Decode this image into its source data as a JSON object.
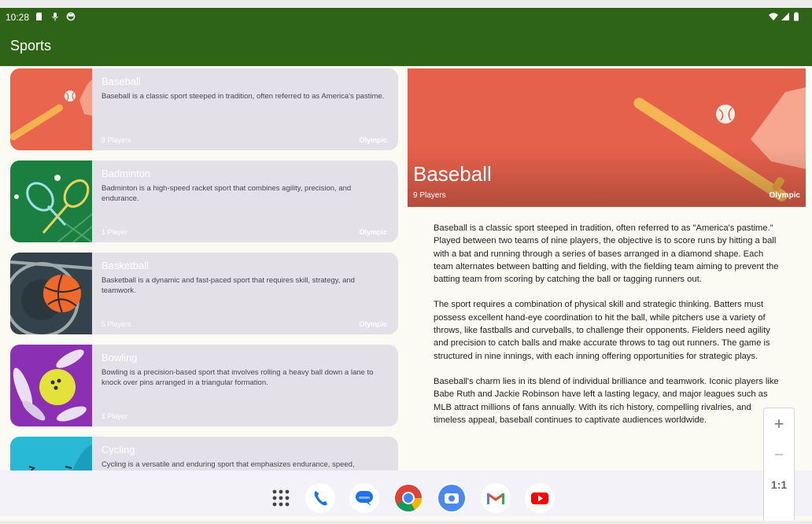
{
  "status_bar": {
    "time": "10:28"
  },
  "app_bar": {
    "title": "Sports"
  },
  "sports": [
    {
      "title": "Baseball",
      "description": "Baseball is a classic sport steeped in tradition, often referred to as America's pastime.",
      "players": "9 Players",
      "tag": "Olympic",
      "image": "baseball-illustration",
      "bg": "#e8654d"
    },
    {
      "title": "Badminton",
      "description": "Badminton is a high-speed racket sport that combines agility, precision, and endurance.",
      "players": "1 Player",
      "tag": "Olympic",
      "image": "badminton-illustration",
      "bg": "#1a7a40"
    },
    {
      "title": "Basketball",
      "description": "Basketball is a dynamic and fast-paced sport that requires skill, strategy, and teamwork.",
      "players": "5 Players",
      "tag": "Olympic",
      "image": "basketball-illustration",
      "bg": "#34424a"
    },
    {
      "title": "Bowling",
      "description": "Bowling is a precision-based sport that involves rolling a heavy ball down a lane to knock over pins arranged in a triangular formation.",
      "players": "1 Player",
      "tag": "",
      "image": "bowling-illustration",
      "bg": "#8a2fb0"
    },
    {
      "title": "Cycling",
      "description": "Cycling is a versatile and enduring sport that emphasizes endurance, speed,",
      "players": "",
      "tag": "",
      "image": "cycling-illustration",
      "bg": "#25b8d6"
    }
  ],
  "detail": {
    "title": "Baseball",
    "players": "9 Players",
    "tag": "Olympic",
    "paragraphs": [
      "Baseball is a classic sport steeped in tradition, often referred to as \"America's pastime.\" Played between two teams of nine players, the objective is to score runs by hitting a ball with a bat and running through a series of bases arranged in a diamond shape. Each team alternates between batting and fielding, with the fielding team aiming to prevent the batting team from scoring by catching the ball or tagging runners out.",
      "The sport requires a combination of physical skill and strategic thinking. Batters must possess excellent hand-eye coordination to hit the ball, while pitchers use a variety of throws, like fastballs and curveballs, to challenge their opponents. Fielders need agility and precision to catch balls and make accurate throws to tag out runners. The game is structured in nine innings, with each inning offering opportunities for strategic plays.",
      "Baseball's charm lies in its blend of individual brilliance and teamwork. Iconic players like Babe Ruth and Jackie Robinson have left a lasting legacy, and major leagues such as MLB attract millions of fans annually. With its rich history, compelling rivalries, and timeless appeal, baseball continues to captivate audiences worldwide."
    ]
  },
  "zoom_controls": {
    "zoom_in": "+",
    "zoom_out": "−",
    "reset": "1:1"
  },
  "dock": [
    "app-drawer-icon",
    "phone-icon",
    "messages-icon",
    "chrome-icon",
    "camera-icon",
    "gmail-icon",
    "youtube-icon"
  ]
}
